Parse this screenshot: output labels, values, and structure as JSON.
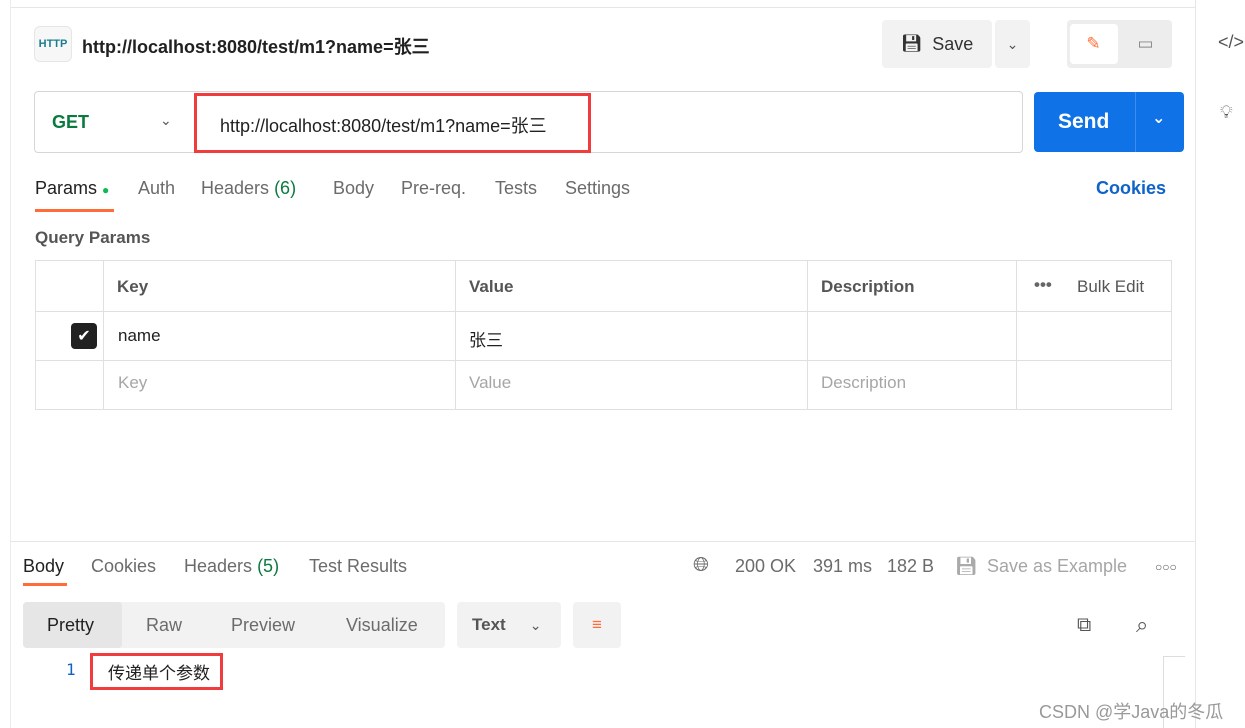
{
  "request": {
    "title": "http://localhost:8080/test/m1?name=张三",
    "icon": "http-icon",
    "method": "GET",
    "url": "http://localhost:8080/test/m1?name=张三",
    "save_label": "Save",
    "send_label": "Send"
  },
  "tabs": [
    {
      "label": "Params"
    },
    {
      "label": "Auth"
    },
    {
      "label": "Headers",
      "count": "(6)"
    },
    {
      "label": "Body"
    },
    {
      "label": "Pre-req."
    },
    {
      "label": "Tests"
    },
    {
      "label": "Settings"
    }
  ],
  "cookies_label": "Cookies",
  "query_params": {
    "title": "Query Params",
    "headers": [
      "Key",
      "Value",
      "Description"
    ],
    "bulk_edit": "Bulk Edit",
    "rows": [
      {
        "checked": true,
        "key": "name",
        "value": "张三",
        "description": ""
      }
    ],
    "placeholders": {
      "key": "Key",
      "value": "Value",
      "description": "Description"
    }
  },
  "response": {
    "tabs": [
      {
        "label": "Body"
      },
      {
        "label": "Cookies"
      },
      {
        "label": "Headers",
        "count": "(5)"
      },
      {
        "label": "Test Results"
      }
    ],
    "status": "200 OK",
    "time": "391 ms",
    "size": "182 B",
    "save_example": "Save as Example",
    "views": [
      "Pretty",
      "Raw",
      "Preview",
      "Visualize"
    ],
    "format": "Text",
    "lines": [
      {
        "num": "1",
        "text": "传递单个参数"
      }
    ]
  },
  "watermark": "CSDN @学Java的冬瓜",
  "colors": {
    "accent": "#ff6c37",
    "send": "#0f72e6",
    "success": "#0b7a3e",
    "highlight": "#f03c3c"
  }
}
